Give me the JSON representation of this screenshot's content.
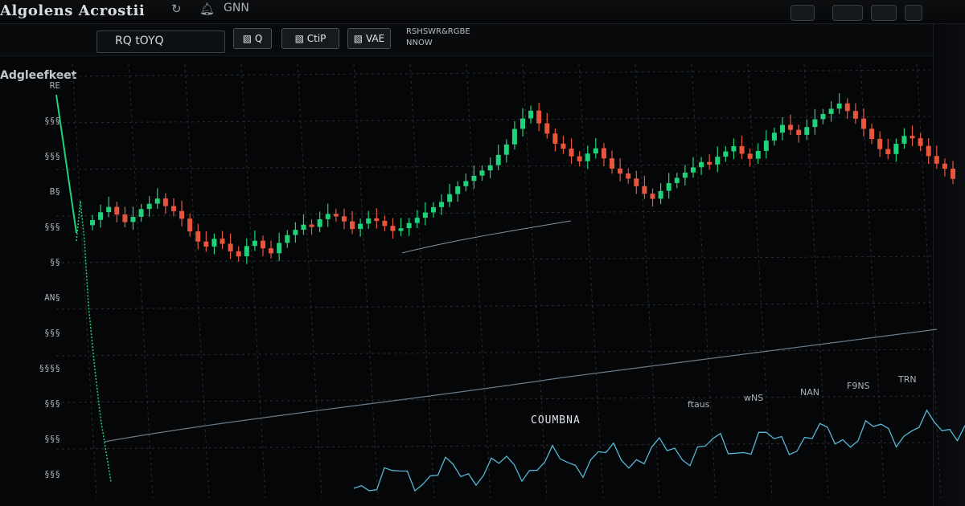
{
  "window": {
    "title": "Algolens Acrostii",
    "top_text": "GNN",
    "icons": [
      "refresh-icon",
      "bell-icon"
    ]
  },
  "toolbar": {
    "symbol": "RQ tOYQ",
    "buttons": [
      "▧ Q",
      "▧ CtiP",
      "▧ VAE"
    ],
    "info_line1": "RSHSWR&RGBE",
    "info_line2": "NNOW"
  },
  "panel": {
    "label": "Adgleefkeet"
  },
  "y_axis": {
    "ticks": [
      "RE",
      "§§§",
      "§§§",
      "B§",
      "§§§",
      "§§",
      "AN§",
      "§§§",
      "§§§§",
      "§§§",
      "§§§",
      "§§§"
    ]
  },
  "indicators": {
    "volume_tag": "COUMBNA",
    "sub_labels": [
      "ftaus",
      "wNS",
      "NAN",
      "F9NS",
      "TRN"
    ]
  },
  "colors": {
    "up": "#1fd37a",
    "down": "#e8553d",
    "grid": "#2a2e33",
    "signal": "#57b7d6"
  },
  "chart_data": {
    "type": "candlestick",
    "title": "",
    "xlabel": "",
    "ylabel": "",
    "ylim": [
      0,
      100
    ],
    "close": [
      55,
      58,
      60,
      57,
      54,
      56,
      59,
      61,
      63,
      60,
      58,
      55,
      50,
      46,
      44,
      47,
      45,
      42,
      40,
      44,
      46,
      43,
      41,
      45,
      48,
      50,
      52,
      51,
      54,
      56,
      55,
      53,
      50,
      52,
      54,
      53,
      51,
      49,
      50,
      52,
      54,
      56,
      58,
      60,
      63,
      66,
      68,
      70,
      72,
      74,
      78,
      82,
      88,
      92,
      95,
      90,
      86,
      82,
      80,
      77,
      75,
      78,
      80,
      76,
      72,
      70,
      68,
      65,
      62,
      60,
      63,
      66,
      68,
      70,
      72,
      74,
      73,
      76,
      78,
      80,
      77,
      75,
      78,
      82,
      85,
      88,
      86,
      84,
      87,
      90,
      92,
      94,
      96,
      93,
      90,
      86,
      82,
      78,
      76,
      80,
      83,
      82,
      79,
      75,
      72,
      70,
      66
    ]
  }
}
